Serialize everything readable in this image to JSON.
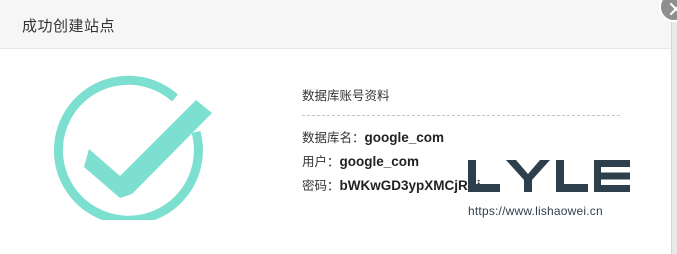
{
  "dialog": {
    "title": "成功创建站点",
    "close_icon": "close-icon",
    "status_icon": "check-circle-icon",
    "accent_color": "#7ddfcf"
  },
  "database_info": {
    "heading": "数据库账号资料",
    "rows": [
      {
        "label": "数据库名：",
        "value": "google_com"
      },
      {
        "label": "用户：",
        "value": "google_com"
      },
      {
        "label": "密码：",
        "value": "bWKwGD3ypXMCjRXi"
      }
    ]
  },
  "watermark": {
    "logo_text": "LYLE",
    "url": "https://www.lishaowei.cn",
    "color": "#2e3f4c"
  }
}
